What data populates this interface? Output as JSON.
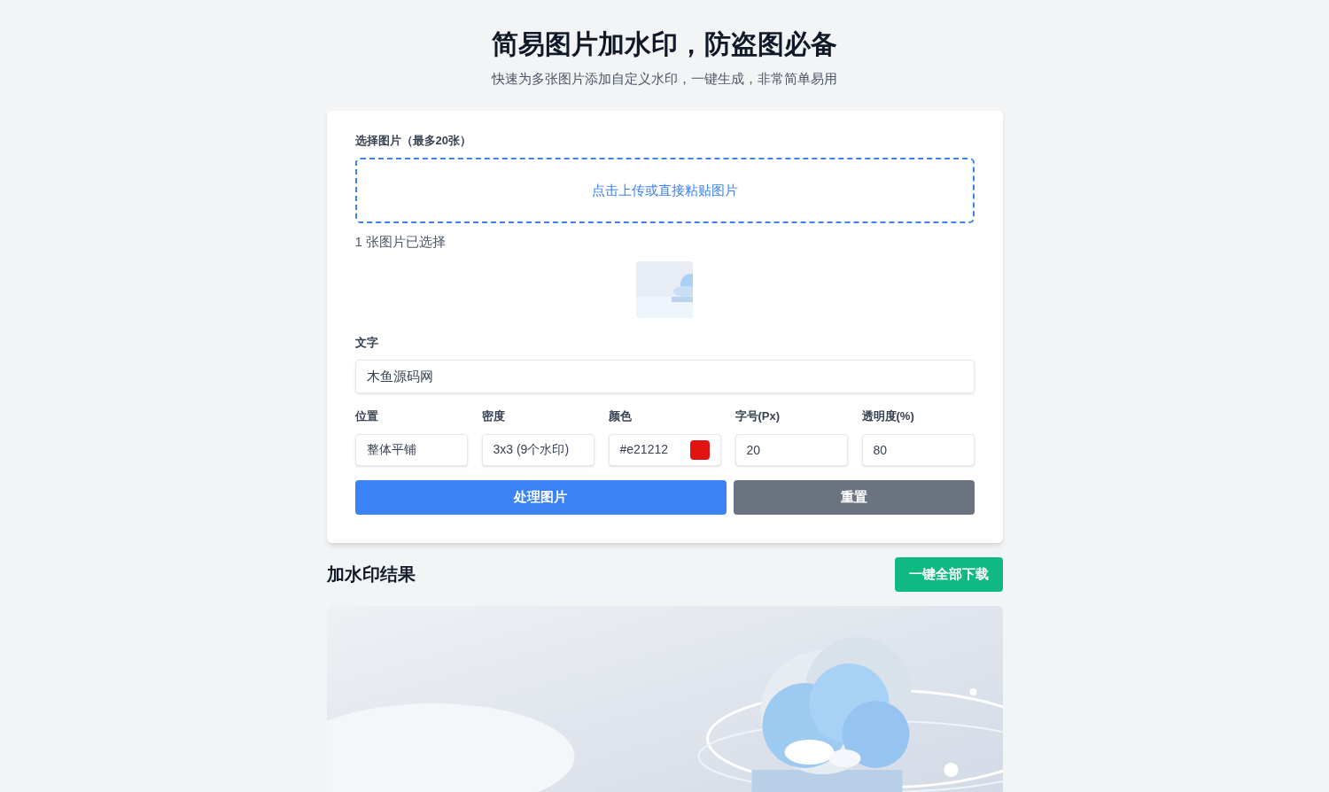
{
  "header": {
    "title": "简易图片加水印，防盗图必备",
    "subtitle": "快速为多张图片添加自定义水印，一键生成，非常简单易用"
  },
  "upload": {
    "label": "选择图片（最多20张）",
    "dropzone": "点击上传或直接粘贴图片",
    "status": "1 张图片已选择"
  },
  "text_field": {
    "label": "文字",
    "value": "木鱼源码网"
  },
  "options": [
    {
      "kind": "select",
      "label": "位置",
      "value": "整体平铺"
    },
    {
      "kind": "select",
      "label": "密度",
      "value": "3x3 (9个水印)"
    },
    {
      "kind": "color",
      "label": "颜色",
      "value": "#e21212",
      "color": "#e21212"
    },
    {
      "kind": "number",
      "label": "字号(Px)",
      "value": "20"
    },
    {
      "kind": "number",
      "label": "透明度(%)",
      "value": "80"
    }
  ],
  "buttons": [
    {
      "kind": "primary",
      "label": "处理图片"
    },
    {
      "kind": "secondary",
      "label": "重置"
    }
  ],
  "results": {
    "title": "加水印结果",
    "download_button": "一键全部下载"
  }
}
